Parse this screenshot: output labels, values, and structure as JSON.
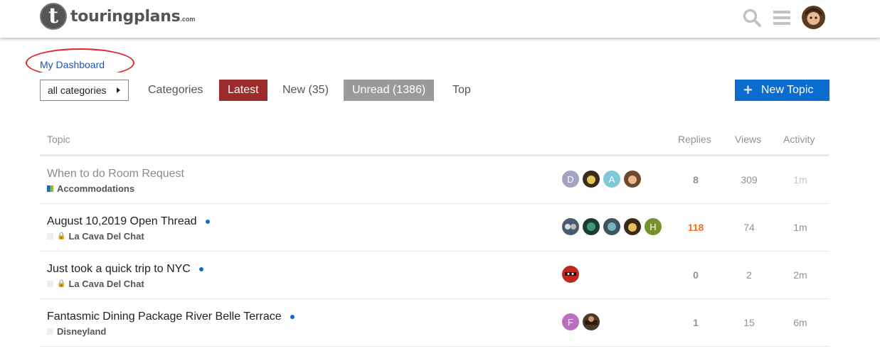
{
  "header": {
    "logo_letter": "t",
    "logo_text": "touringplans",
    "logo_suffix": ".com",
    "icons": [
      "search-icon",
      "hamburger-menu-icon",
      "user-avatar"
    ]
  },
  "dashboard_link": "My Dashboard",
  "nav": {
    "category_dropdown": "all categories",
    "tabs": [
      {
        "label": "Categories"
      },
      {
        "label": "Latest"
      },
      {
        "label": "New (35)"
      },
      {
        "label": "Unread (1386)"
      },
      {
        "label": "Top"
      }
    ],
    "new_topic": "New Topic"
  },
  "table": {
    "headers": {
      "topic": "Topic",
      "replies": "Replies",
      "views": "Views",
      "activity": "Activity"
    },
    "rows": [
      {
        "title": "When to do Room Request",
        "category": "Accommodations",
        "replies": "8",
        "views": "309",
        "activity": "1m",
        "posters": [
          {
            "letter": "D",
            "color": "#a3a3c2"
          },
          {
            "letter": "",
            "color": "#3a2a1a"
          },
          {
            "letter": "A",
            "color": "#7fc8d8"
          },
          {
            "letter": "",
            "color": "#6b4a30"
          }
        ]
      },
      {
        "title": "August 10,2019 Open Thread",
        "category": "La Cava Del Chat",
        "replies": "118",
        "views": "74",
        "activity": "1m",
        "posters": [
          {
            "letter": "",
            "color": "#4a5a70"
          },
          {
            "letter": "",
            "color": "#1f3a30"
          },
          {
            "letter": "",
            "color": "#3d5560"
          },
          {
            "letter": "",
            "color": "#3a2a1a"
          },
          {
            "letter": "H",
            "color": "#7a8f2e"
          }
        ]
      },
      {
        "title": "Just took a quick trip to NYC",
        "category": "La Cava Del Chat",
        "replies": "0",
        "views": "2",
        "activity": "2m",
        "posters": [
          {
            "letter": "",
            "color": "#c0281f"
          }
        ]
      },
      {
        "title": "Fantasmic Dining Package River Belle Terrace",
        "category": "Disneyland",
        "replies": "1",
        "views": "15",
        "activity": "6m",
        "posters": [
          {
            "letter": "F",
            "color": "#b96fc0"
          },
          {
            "letter": "",
            "color": "#4a3a2a"
          }
        ]
      }
    ]
  }
}
